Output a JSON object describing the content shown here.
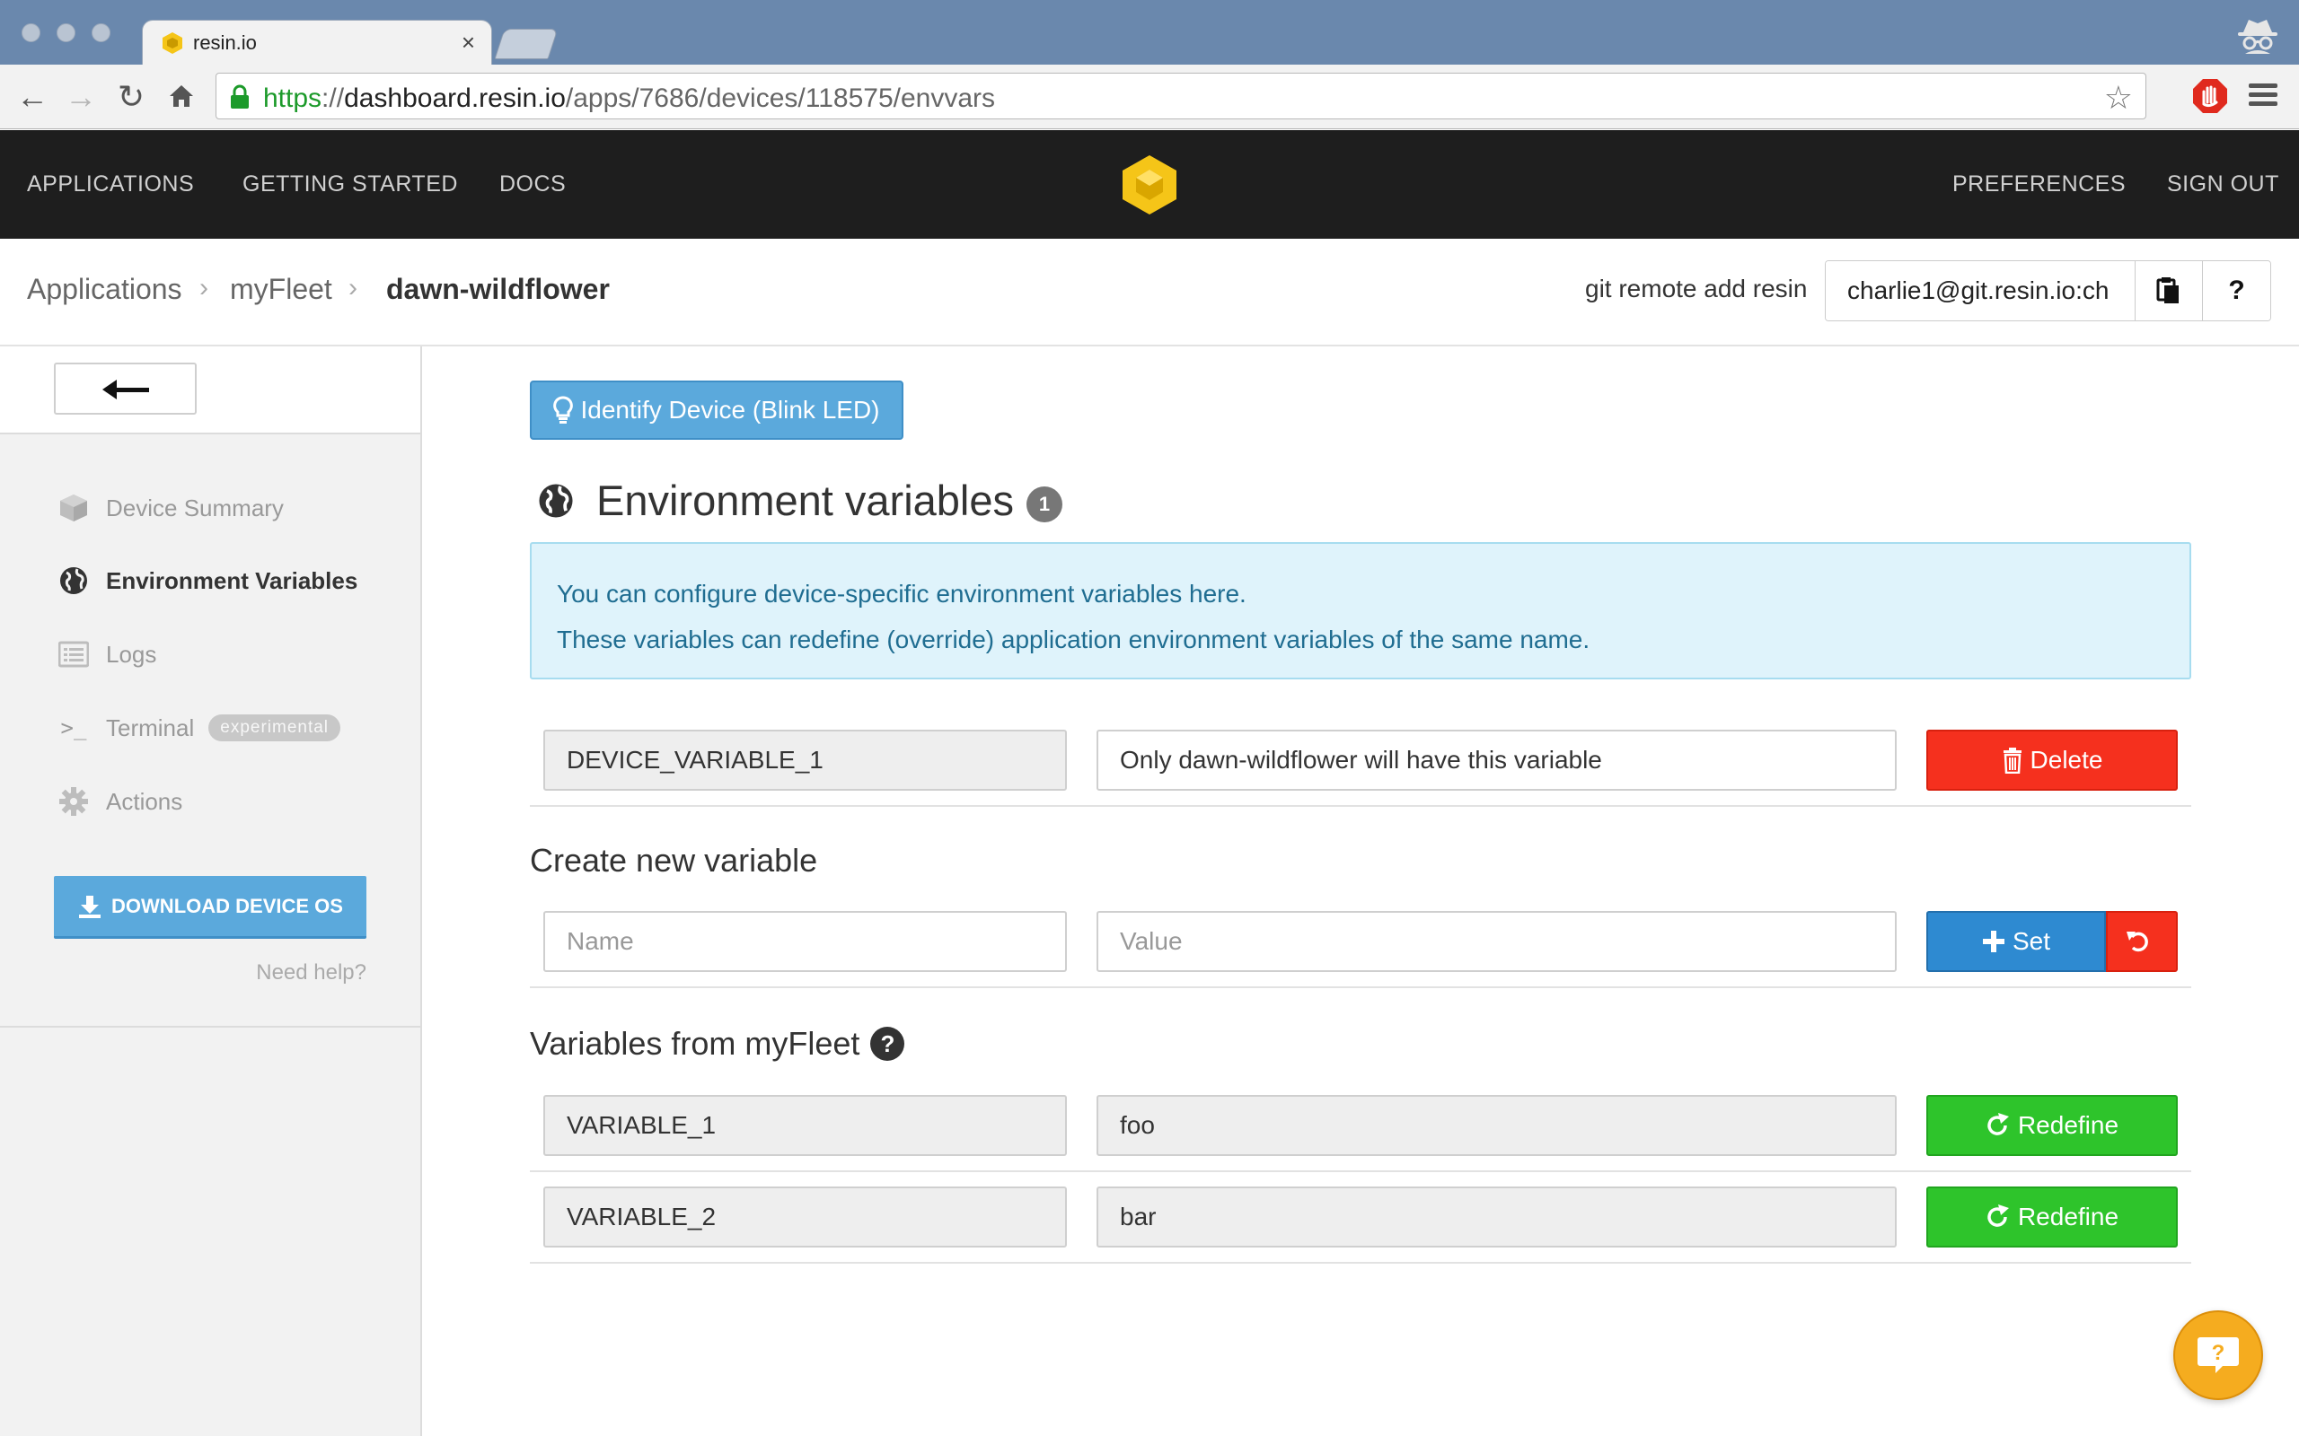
{
  "browser": {
    "tab_title": "resin.io",
    "tab_close": "×",
    "url_scheme": "https",
    "url_sep": "://",
    "url_host": "dashboard.resin.io",
    "url_path": "/apps/7686/devices/118575/envvars"
  },
  "appnav": {
    "left_links": [
      "APPLICATIONS",
      "GETTING STARTED",
      "DOCS"
    ],
    "right_links": [
      "PREFERENCES",
      "SIGN OUT"
    ]
  },
  "breadcrumb": {
    "items": [
      "Applications",
      "myFleet",
      "dawn-wildflower"
    ],
    "separator": "›"
  },
  "git": {
    "label": "git remote add resin",
    "value": "charlie1@git.resin.io:ch",
    "help_label": "?"
  },
  "sidebar": {
    "items": [
      {
        "label": "Device Summary",
        "icon": "cube-icon"
      },
      {
        "label": "Environment Variables",
        "icon": "globe-icon",
        "active": true
      },
      {
        "label": "Logs",
        "icon": "list-icon"
      },
      {
        "label": "Terminal",
        "icon": "terminal-icon",
        "badge": "experimental",
        "prefix": ">_"
      },
      {
        "label": "Actions",
        "icon": "gear-icon"
      }
    ],
    "download_label": "DOWNLOAD DEVICE OS",
    "need_help": "Need help?"
  },
  "main": {
    "identify_label": "Identify Device (Blink LED)",
    "title": "Environment variables",
    "count": "1",
    "info_lines": [
      "You can configure device-specific environment variables here.",
      "These variables can redefine (override) application environment variables of the same name."
    ],
    "device_vars": [
      {
        "name": "DEVICE_VARIABLE_1",
        "value": "Only dawn-wildflower will have this variable",
        "action": "Delete"
      }
    ],
    "create": {
      "heading": "Create new variable",
      "name_placeholder": "Name",
      "value_placeholder": "Value",
      "set_label": "Set"
    },
    "app_vars": {
      "heading": "Variables from myFleet",
      "help_label": "?",
      "items": [
        {
          "name": "VARIABLE_1",
          "value": "foo",
          "action": "Redefine"
        },
        {
          "name": "VARIABLE_2",
          "value": "bar",
          "action": "Redefine"
        }
      ]
    }
  },
  "colors": {
    "nav_bg": "#1e1e1e",
    "brand_yellow": "#f5c518",
    "primary_blue": "#5ba9dc",
    "delete_red": "#f5301e",
    "redefine_green": "#2ec42b",
    "set_blue": "#2e8ad1",
    "chat_orange": "#f5ac1f"
  }
}
